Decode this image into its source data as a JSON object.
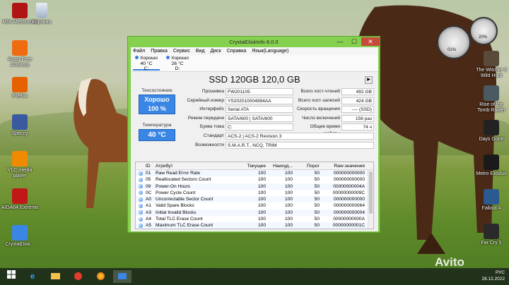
{
  "desktop_icons_left": [
    {
      "name": "msi-afterburner",
      "label": "MSI Afterburner",
      "color": "#b01515"
    },
    {
      "name": "avast-free-antivirus",
      "label": "Avast Free Antivirus",
      "color": "#f06a10"
    },
    {
      "name": "firefox",
      "label": "Firefox",
      "color": "#e66000"
    },
    {
      "name": "speccy",
      "label": "Speccy",
      "color": "#3a5aa0"
    },
    {
      "name": "vlc-media-player",
      "label": "VLC media player",
      "color": "#f08a00"
    },
    {
      "name": "aida64-extreme",
      "label": "AIDA64 Extreme",
      "color": "#c21717"
    },
    {
      "name": "crystaldiskinfo",
      "label": "CrystalDisk...",
      "color": "#3a86e5"
    }
  ],
  "recycle_bin": {
    "label": "Корзина"
  },
  "desktop_icons_right": [
    {
      "name": "the-witcher",
      "label": "The Witcher 3 Wild Hunt",
      "color": "#5a4a3a"
    },
    {
      "name": "rise-of-tomb-raider",
      "label": "Rise of the Tomb Raider",
      "color": "#4a5a60"
    },
    {
      "name": "days-gone",
      "label": "Days Gone",
      "color": "#222222"
    },
    {
      "name": "metro-exodus",
      "label": "Metro Exodus",
      "color": "#1a1a1a"
    },
    {
      "name": "fallout-4",
      "label": "Fallout 4",
      "color": "#2a5a90"
    },
    {
      "name": "far-cry-5",
      "label": "Far Cry 5",
      "color": "#2a2a2a"
    }
  ],
  "gauges": {
    "cpu_percent": "01%",
    "mem_percent": "20%"
  },
  "window": {
    "title": "CrystalDiskInfo 8.0.0",
    "minimize": "—",
    "maximize": "☐",
    "close": "✕",
    "menu": [
      "Файл",
      "Правка",
      "Сервис",
      "Вид",
      "Диск",
      "Справка",
      "Язык(Language)"
    ],
    "drives": [
      {
        "status": "Хорошо",
        "temp": "40 °C",
        "letter": "C:"
      },
      {
        "status": "Хорошо",
        "temp": "26 °C",
        "letter": "D:"
      }
    ],
    "model": "SSD 120GB 120,0 GB",
    "play": "▶",
    "health_label": "Техсостояние",
    "health_status": "Хорошо",
    "health_percent": "100 %",
    "temp_label": "Температура",
    "temp_value": "40 °C",
    "info_mid": [
      {
        "label": "Прошивка",
        "value": "FW201105"
      },
      {
        "label": "Серийный номер",
        "value": "YS202010004984AA"
      },
      {
        "label": "Интерфейс",
        "value": "Serial ATA"
      },
      {
        "label": "Режим передачи",
        "value": "SATA/600 | SATA/600"
      },
      {
        "label": "Буква тома",
        "value": "C:"
      }
    ],
    "info_right": [
      {
        "label": "Всего хост-чтений",
        "value": "492 GB"
      },
      {
        "label": "Всего хост-записей",
        "value": "424 GB"
      },
      {
        "label": "Скорость вращения",
        "value": "---- (SSD)"
      },
      {
        "label": "Число включений",
        "value": "156 раз"
      },
      {
        "label": "Общее время работы",
        "value": "74 ч"
      }
    ],
    "standard_label": "Стандарт",
    "standard_value": "ACS-2 | ACS-2 Revision 3",
    "features_label": "Возможности",
    "features_value": "S.M.A.R.T., NCQ, TRIM",
    "table_headers": [
      "ID",
      "Атрибут",
      "Текущее",
      "Наихуд...",
      "Порог",
      "Raw-значения"
    ],
    "smart_rows": [
      {
        "id": "01",
        "attr": "Raw Read Error Rate",
        "cur": "100",
        "worst": "100",
        "thr": "50",
        "raw": "000000000000"
      },
      {
        "id": "05",
        "attr": "Reallocated Sectors Count",
        "cur": "100",
        "worst": "100",
        "thr": "50",
        "raw": "000000000000"
      },
      {
        "id": "09",
        "attr": "Power-On Hours",
        "cur": "100",
        "worst": "100",
        "thr": "50",
        "raw": "00000000004A"
      },
      {
        "id": "0C",
        "attr": "Power Cycle Count",
        "cur": "100",
        "worst": "100",
        "thr": "50",
        "raw": "00000000009C"
      },
      {
        "id": "A0",
        "attr": "Uncorrectable Sector Count",
        "cur": "100",
        "worst": "100",
        "thr": "50",
        "raw": "000000000000"
      },
      {
        "id": "A1",
        "attr": "Valid Spare Blocks",
        "cur": "100",
        "worst": "100",
        "thr": "50",
        "raw": "000000000064"
      },
      {
        "id": "A3",
        "attr": "Initial Invalid Blocks",
        "cur": "100",
        "worst": "100",
        "thr": "50",
        "raw": "000000000004"
      },
      {
        "id": "A4",
        "attr": "Total TLC Erase Count",
        "cur": "100",
        "worst": "100",
        "thr": "50",
        "raw": "00000000000A"
      },
      {
        "id": "A5",
        "attr": "Maximum TLC Erase Count",
        "cur": "100",
        "worst": "100",
        "thr": "50",
        "raw": "00000000001C"
      },
      {
        "id": "A6",
        "attr": "Minimum TLC Erase Count",
        "cur": "100",
        "worst": "100",
        "thr": "50",
        "raw": "000000000004"
      }
    ]
  },
  "taskbar": {
    "start_icon": "windows-logo",
    "tray_lang": "РУС",
    "date": "28.12.2022"
  },
  "watermark": "Avito"
}
